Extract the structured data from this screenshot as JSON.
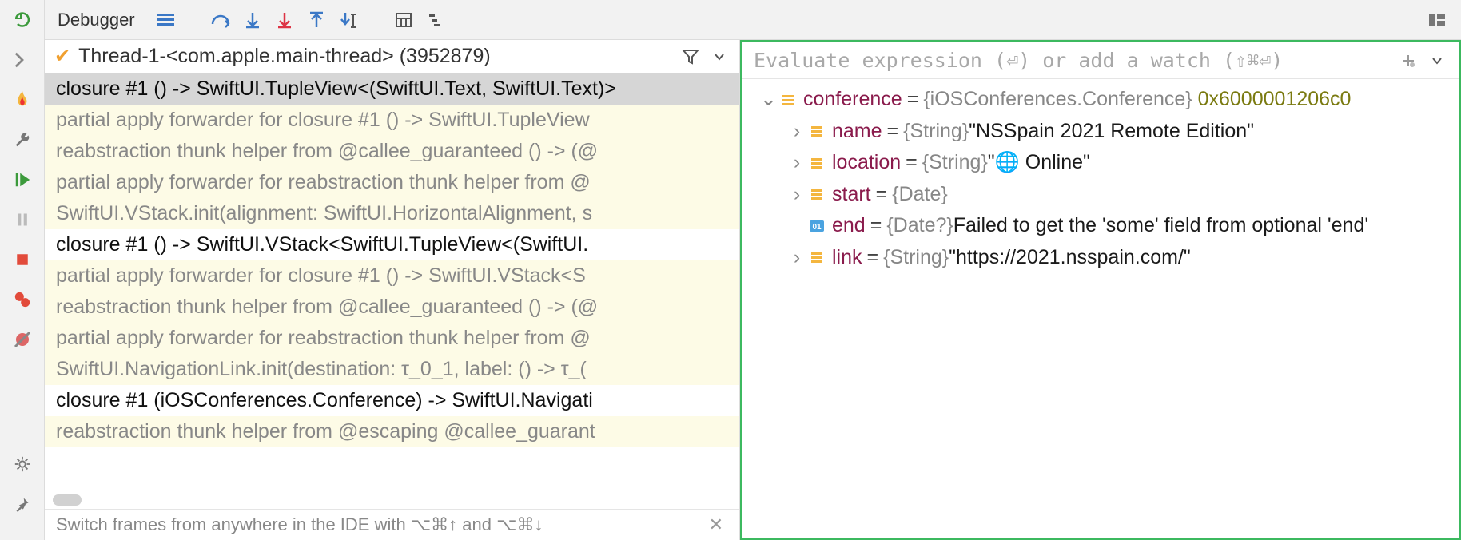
{
  "toolbar": {
    "title": "Debugger"
  },
  "thread": {
    "title": "Thread-1-<com.apple.main-thread> (3952879)"
  },
  "frames": [
    {
      "style": "selected",
      "text": "closure #1 () -> SwiftUI.TupleView<(SwiftUI.Text, SwiftUI.Text)>"
    },
    {
      "style": "dim",
      "text": "partial apply forwarder for closure #1 () -> SwiftUI.TupleView"
    },
    {
      "style": "dim",
      "text": "reabstraction thunk helper from @callee_guaranteed () -> (@"
    },
    {
      "style": "dim",
      "text": "partial apply forwarder for reabstraction thunk helper from @"
    },
    {
      "style": "dim",
      "text": "SwiftUI.VStack.init(alignment: SwiftUI.HorizontalAlignment, s"
    },
    {
      "style": "normal",
      "text": "closure #1 () -> SwiftUI.VStack<SwiftUI.TupleView<(SwiftUI."
    },
    {
      "style": "dim",
      "text": "partial apply forwarder for closure #1 () -> SwiftUI.VStack<S"
    },
    {
      "style": "dim",
      "text": "reabstraction thunk helper from @callee_guaranteed () -> (@"
    },
    {
      "style": "dim",
      "text": "partial apply forwarder for reabstraction thunk helper from @"
    },
    {
      "style": "dim",
      "text": "SwiftUI.NavigationLink.init(destination: τ_0_1, label: () -> τ_("
    },
    {
      "style": "normal",
      "text": "closure #1 (iOSConferences.Conference) -> SwiftUI.Navigati"
    },
    {
      "style": "dim",
      "text": "reabstraction thunk helper from @escaping @callee_guarant"
    }
  ],
  "hint": {
    "text": "Switch frames from anywhere in the IDE with ⌥⌘↑ and ⌥⌘↓"
  },
  "eval": {
    "placeholder": "Evaluate expression (⏎) or add a watch (⇧⌘⏎)"
  },
  "vars": {
    "root": {
      "name": "conference",
      "type": "{iOSConferences.Conference}",
      "addr": "0x6000001206c0"
    },
    "children": [
      {
        "icon": "field",
        "name": "name",
        "type": "{String}",
        "val": "\"NSSpain 2021 Remote Edition\"",
        "expandable": true
      },
      {
        "icon": "field",
        "name": "location",
        "type": "{String}",
        "val": "\"🌐 Online\"",
        "expandable": true
      },
      {
        "icon": "field",
        "name": "start",
        "type": "{Date}",
        "val": "",
        "expandable": true
      },
      {
        "icon": "prim",
        "name": "end",
        "type": "{Date?}",
        "val": "Failed to get the 'some' field from optional 'end'",
        "expandable": false
      },
      {
        "icon": "field",
        "name": "link",
        "type": "{String}",
        "val": "\"https://2021.nsspain.com/\"",
        "expandable": true
      }
    ]
  }
}
